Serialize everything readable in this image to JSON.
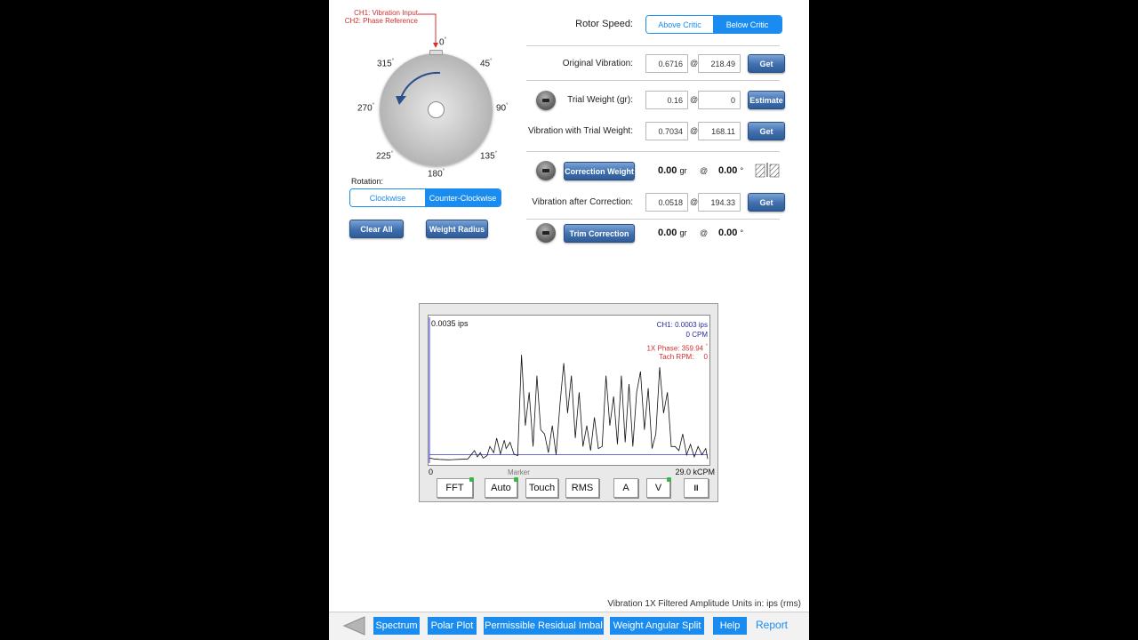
{
  "rotor": {
    "ch1_label": "CH1: Vibration Input",
    "ch2_label": "CH2: Phase Reference",
    "degrees": [
      "0",
      "45",
      "90",
      "135",
      "180",
      "225",
      "270",
      "315"
    ],
    "degree_symbol": "°",
    "rotation_label": "Rotation:",
    "rotation_options": [
      "Clockwise",
      "Counter-Clockwise"
    ],
    "rotation_selected": "Counter-Clockwise",
    "clear_all": "Clear All",
    "weight_radius": "Weight Radius"
  },
  "rotor_speed": {
    "label": "Rotor Speed:",
    "options": [
      "Above Critic",
      "Below Critic"
    ],
    "selected": "Below Critic"
  },
  "original_vibration": {
    "label": "Original Vibration:",
    "amp": "0.6716",
    "phase": "218.49",
    "button": "Get"
  },
  "trial_weight": {
    "label": "Trial Weight (gr):",
    "amp": "0.16",
    "phase": "0",
    "button": "Estimate"
  },
  "vibration_trial": {
    "label": "Vibration with Trial Weight:",
    "amp": "0.7034",
    "phase": "168.11",
    "button": "Get"
  },
  "correction_weight": {
    "button": "Correction Weight",
    "value": "0.00",
    "unit": "gr",
    "angle": "0.00"
  },
  "vibration_after": {
    "label": "Vibration after Correction:",
    "amp": "0.0518",
    "phase": "194.33",
    "button": "Get"
  },
  "trim_correction": {
    "button": "Trim Correction",
    "value": "0.00",
    "unit": "gr",
    "angle": "0.00"
  },
  "at_symbol": "@",
  "spectrum": {
    "top_left": "0.0035 ips",
    "ch1_readout": "CH1: 0.0003 ips",
    "cpm_readout": "0 CPM",
    "phase_readout": "1X Phase: 359.94",
    "tach_readout": "Tach RPM:",
    "tach_value": "0",
    "x_start": "0",
    "x_end": "29.0 kCPM",
    "marker_label": "Marker",
    "controls": {
      "fft": "FFT",
      "auto": "Auto",
      "touch": "Touch",
      "rms": "RMS",
      "a": "A",
      "v": "V",
      "pause": "II"
    }
  },
  "chart_data": {
    "type": "line",
    "xlabel": "",
    "ylabel": "",
    "xlim": [
      0,
      29.0
    ],
    "ylim": [
      0,
      0.0035
    ],
    "series": [
      {
        "x": [
          0,
          0.5,
          1,
          2,
          3,
          4,
          4.7,
          5,
          5.3,
          5.6,
          6,
          6.3,
          6.7,
          7,
          7.4,
          7.8,
          8,
          8.4,
          8.8,
          9.2,
          9.6,
          10,
          10.4,
          10.8,
          11.2,
          11.6,
          12,
          12.4,
          12.8,
          13.2,
          13.6,
          14,
          14.4,
          14.8,
          15.2,
          15.6,
          16,
          16.4,
          16.8,
          17.2,
          17.6,
          18,
          18.4,
          18.8,
          19.2,
          19.6,
          20,
          20.4,
          20.8,
          21.2,
          21.6,
          22,
          22.4,
          22.8,
          23.2,
          23.6,
          24,
          24.4,
          24.8,
          25.2,
          25.6,
          26,
          26.4,
          26.8,
          27.2,
          27.6,
          28,
          28.4,
          28.8,
          29
        ],
        "y": [
          0.00012,
          0.0001,
          9e-05,
          8e-05,
          9e-05,
          0.0001,
          0.0003,
          0.00015,
          0.00025,
          0.00012,
          0.00018,
          0.0004,
          0.00025,
          0.0006,
          0.00022,
          0.00055,
          0.00035,
          0.0005,
          0.00022,
          0.00018,
          0.0026,
          0.0009,
          0.0017,
          0.0004,
          0.0021,
          0.0008,
          0.0007,
          0.00025,
          0.0009,
          0.0002,
          0.0014,
          0.0024,
          0.0012,
          0.0021,
          0.0006,
          0.0017,
          0.0004,
          0.0009,
          0.0003,
          0.0011,
          0.00035,
          0.0004,
          0.0021,
          0.0009,
          0.0016,
          0.00045,
          0.0021,
          0.0005,
          0.0019,
          0.0004,
          0.0017,
          0.0022,
          0.0008,
          0.0018,
          0.00035,
          0.0007,
          0.0023,
          0.0012,
          0.0017,
          0.0004,
          0.0004,
          0.0003,
          0.0007,
          0.0002,
          0.00045,
          0.00015,
          0.0004,
          0.0002,
          0.00035,
          0.0001
        ]
      }
    ]
  },
  "units_footer": "Vibration 1X Filtered Amplitude Units in: ips (rms)",
  "toolbar": {
    "spectrum": "Spectrum",
    "polar_plot": "Polar Plot",
    "permissible": "Permissible Residual Imbal",
    "weight_split": "Weight Angular Split",
    "help": "Help",
    "report": "Report"
  },
  "colors": {
    "accent": "#1a8cf0",
    "button_blue": "#3f6fae",
    "phase_red": "#d03030",
    "readout_blue": "#2a2a9a"
  }
}
